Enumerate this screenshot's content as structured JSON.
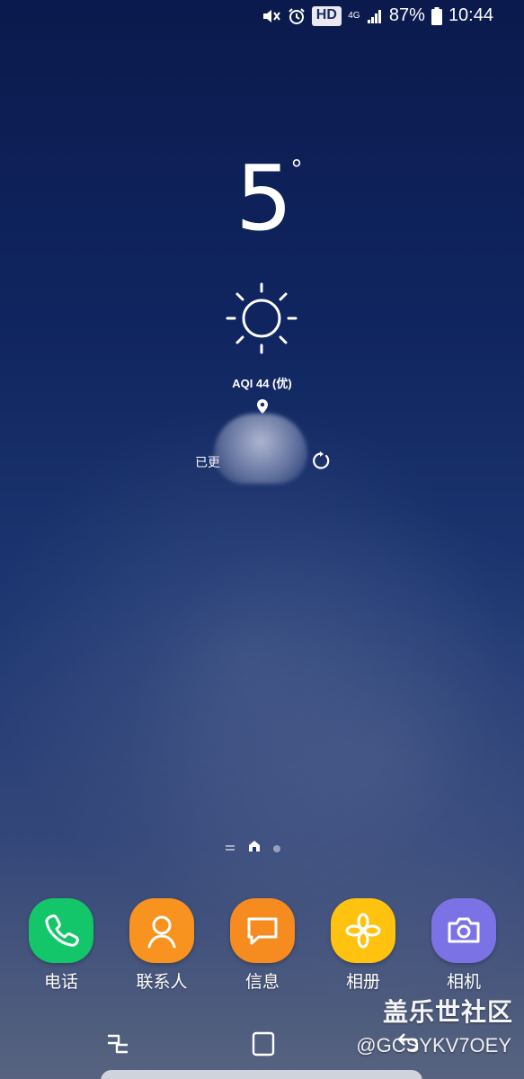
{
  "status_bar": {
    "hd_label": "HD",
    "network_label": "4G",
    "battery_percent": "87%",
    "time": "10:44",
    "icons": [
      "mute-icon",
      "alarm-icon",
      "signal-icon",
      "battery-icon"
    ]
  },
  "weather": {
    "temperature": "5",
    "degree_symbol": "°",
    "condition_icon": "sun-icon",
    "aqi": "AQI 44 (优)",
    "location_prefix": "已更"
  },
  "page_indicator": {
    "icons": [
      "menu-lines-icon",
      "home-icon",
      "dot-icon"
    ]
  },
  "dock": {
    "apps": [
      {
        "label": "电话",
        "icon": "phone-icon",
        "color": "#13c66a"
      },
      {
        "label": "联系人",
        "icon": "contacts-icon",
        "color": "#f7931e"
      },
      {
        "label": "信息",
        "icon": "message-icon",
        "color": "#f68b1f"
      },
      {
        "label": "相册",
        "icon": "gallery-icon",
        "color": "#ffc20e"
      },
      {
        "label": "相机",
        "icon": "camera-icon",
        "color": "#7b72e6"
      }
    ]
  },
  "nav_bar": {
    "icons": [
      "recents-icon",
      "home-button-icon",
      "back-icon"
    ]
  },
  "watermark": {
    "title": "盖乐世社区",
    "handle": "@GCSYKV7OEY"
  }
}
